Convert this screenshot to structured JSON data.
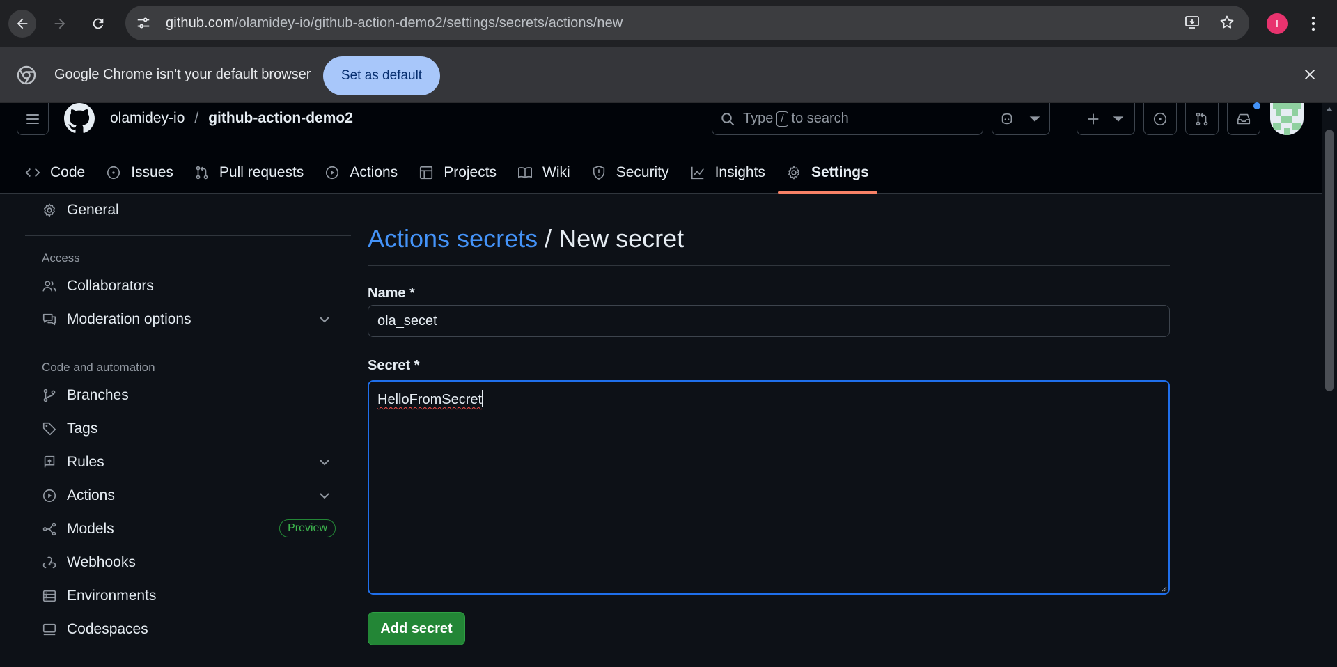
{
  "browser": {
    "url_host": "github.com",
    "url_path": "/olamidey-io/github-action-demo2/settings/secrets/actions/new",
    "profile_initial": "I",
    "infobar_message": "Google Chrome isn't your default browser",
    "infobar_button": "Set as default"
  },
  "header": {
    "owner": "olamidey-io",
    "separator": "/",
    "repo": "github-action-demo2",
    "search_prefix": "Type",
    "search_key": "/",
    "search_suffix": "to search"
  },
  "repo_tabs": [
    {
      "label": "Code",
      "icon": "code-icon"
    },
    {
      "label": "Issues",
      "icon": "issue-icon"
    },
    {
      "label": "Pull requests",
      "icon": "pull-request-icon"
    },
    {
      "label": "Actions",
      "icon": "play-icon"
    },
    {
      "label": "Projects",
      "icon": "table-icon"
    },
    {
      "label": "Wiki",
      "icon": "book-icon"
    },
    {
      "label": "Security",
      "icon": "shield-icon"
    },
    {
      "label": "Insights",
      "icon": "graph-icon"
    },
    {
      "label": "Settings",
      "icon": "gear-icon",
      "active": true
    }
  ],
  "sidebar": {
    "general": "General",
    "access_heading": "Access",
    "collaborators": "Collaborators",
    "moderation": "Moderation options",
    "code_heading": "Code and automation",
    "branches": "Branches",
    "tags": "Tags",
    "rules": "Rules",
    "actions": "Actions",
    "models": "Models",
    "models_badge": "Preview",
    "webhooks": "Webhooks",
    "environments": "Environments",
    "codespaces": "Codespaces"
  },
  "main": {
    "breadcrumb_link": "Actions secrets",
    "title_rest": " / New secret",
    "name_label": "Name *",
    "name_value": "ola_secet",
    "secret_label": "Secret *",
    "secret_value": "HelloFromSecret",
    "submit_label": "Add secret"
  },
  "colors": {
    "accent_link": "#4493f8",
    "primary_button": "#238636",
    "active_tab_underline": "#f78166",
    "focus_border": "#1f6feb"
  }
}
